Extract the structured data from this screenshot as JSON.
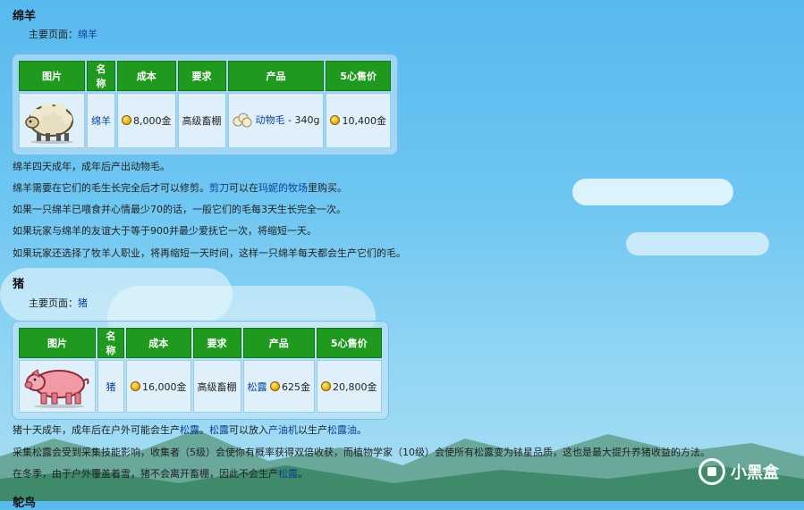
{
  "sheep": {
    "title": "绵羊",
    "main_page_label": "主要页面：",
    "main_page_link": "绵羊",
    "headers": [
      "图片",
      "名称",
      "成本",
      "要求",
      "产品",
      "5心售价"
    ],
    "name": "绵羊",
    "cost": "8,000金",
    "requirement": "高级畜棚",
    "product_link": "动物毛",
    "product_price": "- 340g",
    "sell_price": "10,400金",
    "para1": "绵羊四天成年，成年后产出动物毛。",
    "para2_a": "绵羊需要在它们的毛生长完全后才可以修剪。",
    "para2_link1": "剪刀",
    "para2_b": "可以在",
    "para2_link2": "玛妮的牧场",
    "para2_c": "里购买。",
    "para3": "如果一只绵羊已喂食并心情最少70的话，一般它们的毛每3天生长完全一次。",
    "para4": "如果玩家与绵羊的友谊大于等于900并最少爱抚它一次，将缩短一天。",
    "para5": "如果玩家还选择了牧羊人职业，将再缩短一天时间，这样一只绵羊每天都会生产它们的毛。"
  },
  "pig": {
    "title": "猪",
    "main_page_label": "主要页面：",
    "main_page_link": "猪",
    "headers": [
      "图片",
      "名称",
      "成本",
      "要求",
      "产品",
      "5心售价"
    ],
    "name": "猪",
    "cost": "16,000金",
    "requirement": "高级畜棚",
    "product_link": "松露",
    "product_price": "625金",
    "sell_price": "20,800金",
    "para1_a": "猪十天成年，成年后在户外可能会生产",
    "para1_link1": "松露",
    "para1_b": "。",
    "para1_link2": "松露",
    "para1_c": "可以放入",
    "para1_link3": "产油机",
    "para1_d": "以生产",
    "para1_link4": "松露油",
    "para1_e": "。",
    "para2": "采集松露会受到采集技能影响，收集者（5级）会使你有概率获得双倍收获，而植物学家（10级）会使所有松露变为铱星品质，这也是最大提升养猪收益的方法。",
    "para3_a": "在冬季，由于户外覆盖着雪，猪不会离开畜棚，因此不会生产",
    "para3_link": "松露",
    "para3_b": "。"
  },
  "next_section_title": "鸵鸟",
  "watermark": "小黑盒",
  "colors": {
    "header_green": "#1f9a1f",
    "link_blue": "#0b3f99",
    "sky_top": "#58b9ee"
  }
}
